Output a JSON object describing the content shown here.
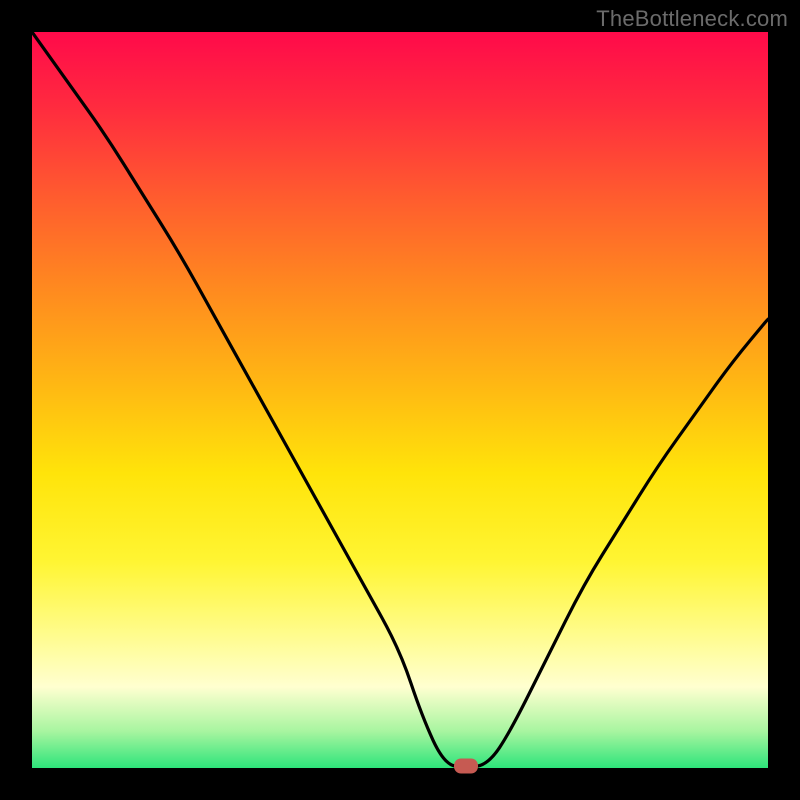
{
  "attribution": "TheBottleneck.com",
  "colors": {
    "frame": "#000000",
    "gradient_top": "#ff0a4a",
    "gradient_bottom": "#2de47a",
    "curve": "#000000",
    "marker": "#c65a52"
  },
  "chart_data": {
    "type": "line",
    "title": "",
    "xlabel": "",
    "ylabel": "",
    "xlim": [
      0,
      100
    ],
    "ylim": [
      0,
      100
    ],
    "x": [
      0,
      5,
      10,
      15,
      20,
      25,
      30,
      35,
      40,
      45,
      50,
      53,
      56,
      59,
      62,
      65,
      70,
      75,
      80,
      85,
      90,
      95,
      100
    ],
    "values": [
      100,
      93,
      86,
      78,
      70,
      61,
      52,
      43,
      34,
      25,
      16,
      7,
      0.5,
      0,
      0.5,
      5,
      15,
      25,
      33,
      41,
      48,
      55,
      61
    ],
    "min_at_x": 59,
    "min_value": 0,
    "marker": {
      "x": 59,
      "y": 0
    },
    "note": "Plot shows a V-shaped bottleneck curve over a vertical heat gradient; values read from line height within the plot box."
  }
}
